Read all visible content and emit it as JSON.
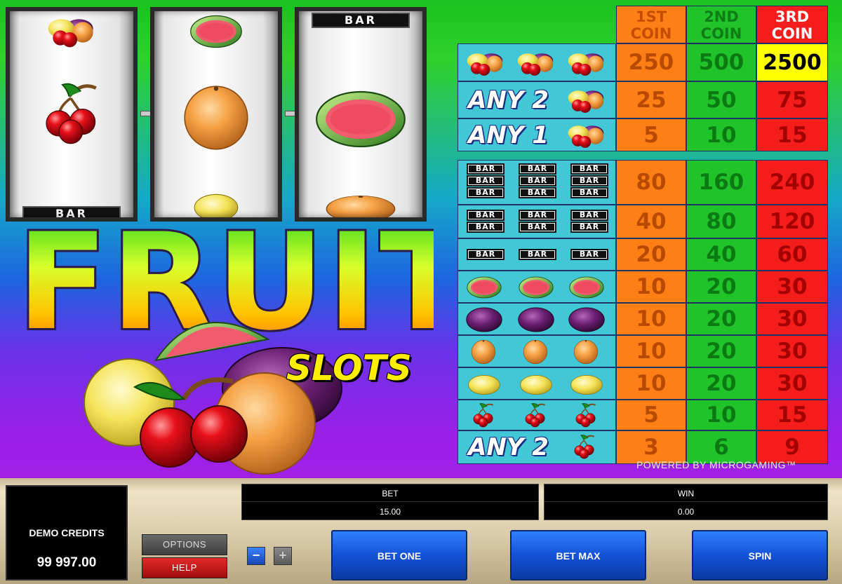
{
  "paytable": {
    "headers": [
      {
        "line1": "1ST",
        "line2": "COIN"
      },
      {
        "line1": "2ND",
        "line2": "COIN"
      },
      {
        "line1": "3RD",
        "line2": "COIN"
      }
    ],
    "rows": [
      {
        "symbol": "mixed-fruit x3",
        "values": [
          "250",
          "500",
          "2500"
        ]
      },
      {
        "symbol": "any 2 mixed-fruit",
        "label": "ANY 2",
        "values": [
          "25",
          "50",
          "75"
        ]
      },
      {
        "symbol": "any 1 mixed-fruit",
        "label": "ANY 1",
        "values": [
          "5",
          "10",
          "15"
        ]
      },
      {
        "symbol": "triple bar x3",
        "values": [
          "80",
          "160",
          "240"
        ]
      },
      {
        "symbol": "double bar x3",
        "values": [
          "40",
          "80",
          "120"
        ]
      },
      {
        "symbol": "single bar x3",
        "values": [
          "20",
          "40",
          "60"
        ]
      },
      {
        "symbol": "watermelon x3",
        "values": [
          "10",
          "20",
          "30"
        ]
      },
      {
        "symbol": "plum x3",
        "values": [
          "10",
          "20",
          "30"
        ]
      },
      {
        "symbol": "orange x3",
        "values": [
          "10",
          "20",
          "30"
        ]
      },
      {
        "symbol": "lemon x3",
        "values": [
          "10",
          "20",
          "30"
        ]
      },
      {
        "symbol": "cherry x3",
        "values": [
          "5",
          "10",
          "15"
        ]
      },
      {
        "symbol": "any 2 cherry",
        "label": "ANY 2",
        "values": [
          "3",
          "6",
          "9"
        ]
      }
    ]
  },
  "reels": {
    "bar_label": "BAR"
  },
  "logo": {
    "title": "FRUIT",
    "subtitle": "SLOTS"
  },
  "powered_by": "POWERED BY MICROGAMING™",
  "controls": {
    "credits_label": "DEMO CREDITS",
    "credits_value": "99 997.00",
    "options_label": "OPTIONS",
    "help_label": "HELP",
    "minus_label": "−",
    "plus_label": "+",
    "bet_label": "BET",
    "bet_value": "15.00",
    "win_label": "WIN",
    "win_value": "0.00",
    "bet_one_label": "BET ONE",
    "bet_max_label": "BET MAX",
    "spin_label": "SPIN"
  },
  "colors": {
    "coin1": "#ff7f17",
    "coin2": "#21c32a",
    "coin3": "#f51c1c",
    "highlight": "#ffff00",
    "button_blue": "#1452d8"
  }
}
